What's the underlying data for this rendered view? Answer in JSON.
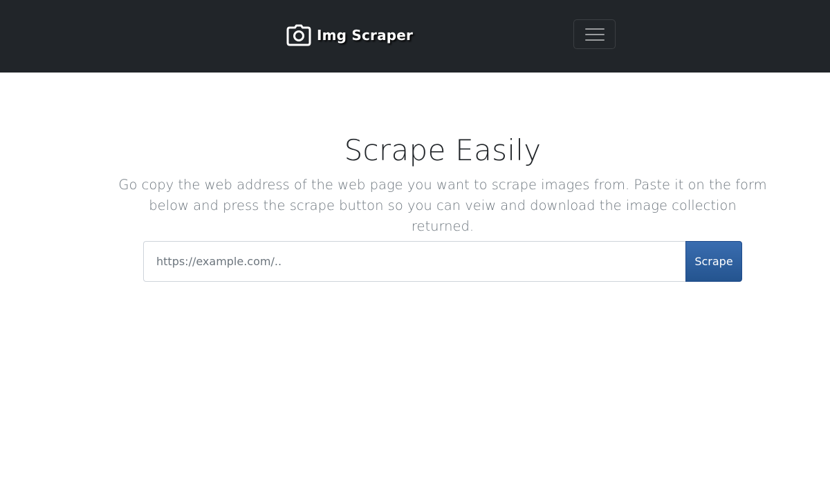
{
  "navbar": {
    "brand_icon": "camera-icon",
    "brand_text": "Img Scraper",
    "toggler_icon": "hamburger-menu-icon",
    "background": "#212529"
  },
  "hero": {
    "title": "Scrape Easily",
    "lead": "Go copy the web address of the web page you want to scrape images from. Paste it on the form below and press the scrape button so you can veiw and download the image collection returned."
  },
  "form": {
    "url_placeholder": "https://example.com/..",
    "url_value": "",
    "submit_label": "Scrape",
    "accent": "#2c5ea0"
  }
}
